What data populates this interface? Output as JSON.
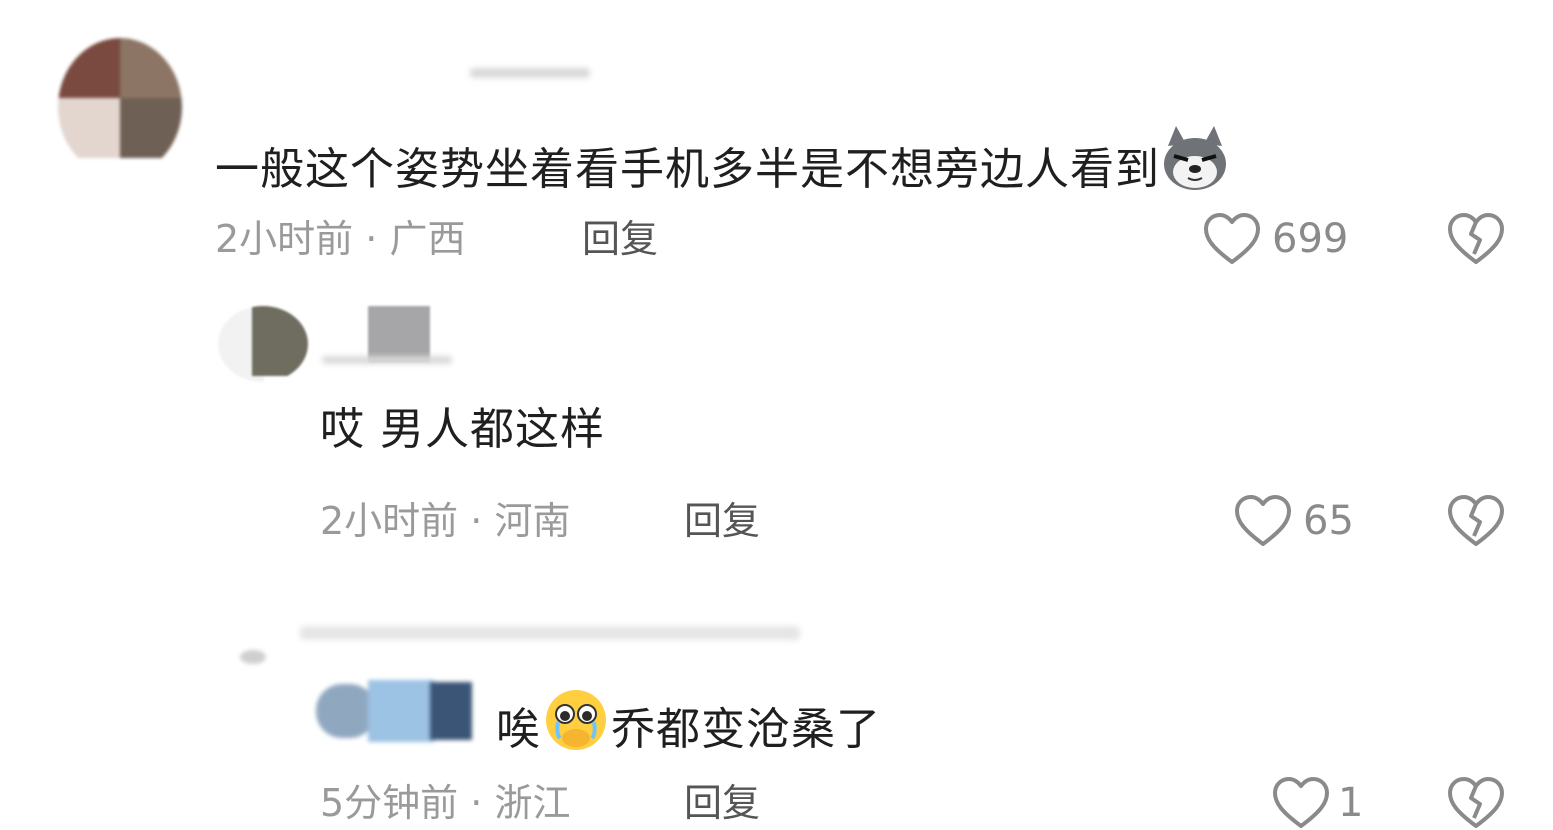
{
  "comments": [
    {
      "text": "一般这个姿势坐着看手机多半是不想旁边人看到",
      "emoji": "husky-dog-emoji",
      "time": "2小时前",
      "location": "广西",
      "reply_label": "回复",
      "likes": "699"
    },
    {
      "text": "哎 男人都这样",
      "time": "2小时前",
      "location": "河南",
      "reply_label": "回复",
      "likes": "65"
    },
    {
      "text_before_emoji": "唉",
      "emoji": "pleading-tears-emoji",
      "text_after_emoji": "乔都变沧桑了",
      "time": "5分钟前",
      "location": "浙江",
      "reply_label": "回复",
      "likes": "1"
    }
  ],
  "separator": " · ",
  "colors": {
    "text": "#1f1f1f",
    "meta": "#9a9a9a",
    "icon": "#8a8a8a"
  },
  "icons": [
    "heart-outline-icon",
    "broken-heart-icon"
  ]
}
